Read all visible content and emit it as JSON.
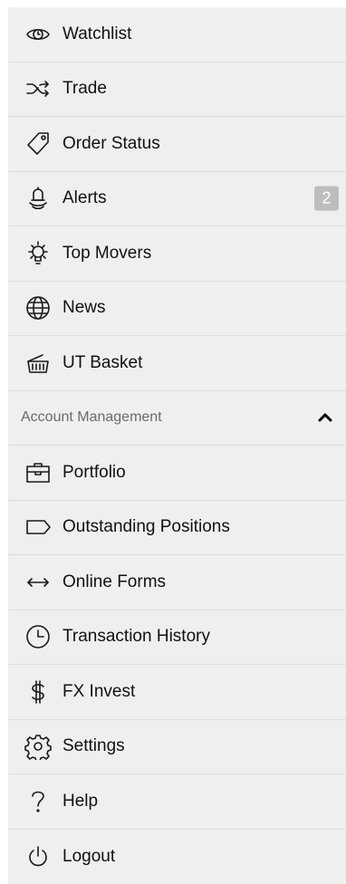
{
  "menu": {
    "items": [
      {
        "label": "Watchlist",
        "icon": "eye-icon"
      },
      {
        "label": "Trade",
        "icon": "shuffle-icon"
      },
      {
        "label": "Order Status",
        "icon": "tag-icon"
      },
      {
        "label": "Alerts",
        "icon": "bell-icon",
        "badge": "2"
      },
      {
        "label": "Top Movers",
        "icon": "lightbulb-icon"
      },
      {
        "label": "News",
        "icon": "globe-icon"
      },
      {
        "label": "UT Basket",
        "icon": "basket-icon"
      }
    ]
  },
  "account": {
    "title": "Account Management",
    "expanded": true,
    "items": [
      {
        "label": "Portfolio",
        "icon": "briefcase-icon"
      },
      {
        "label": "Outstanding Positions",
        "icon": "label-tag-icon"
      },
      {
        "label": "Online Forms",
        "icon": "double-arrow-icon"
      },
      {
        "label": "Transaction History",
        "icon": "clock-icon"
      },
      {
        "label": "FX Invest",
        "icon": "dollar-icon"
      },
      {
        "label": "Settings",
        "icon": "gear-icon"
      },
      {
        "label": "Help",
        "icon": "question-icon"
      },
      {
        "label": "Logout",
        "icon": "power-icon"
      }
    ]
  },
  "colors": {
    "background": "#efefef",
    "badge": "#bdbdbd",
    "section_text": "#6b6b6b"
  }
}
